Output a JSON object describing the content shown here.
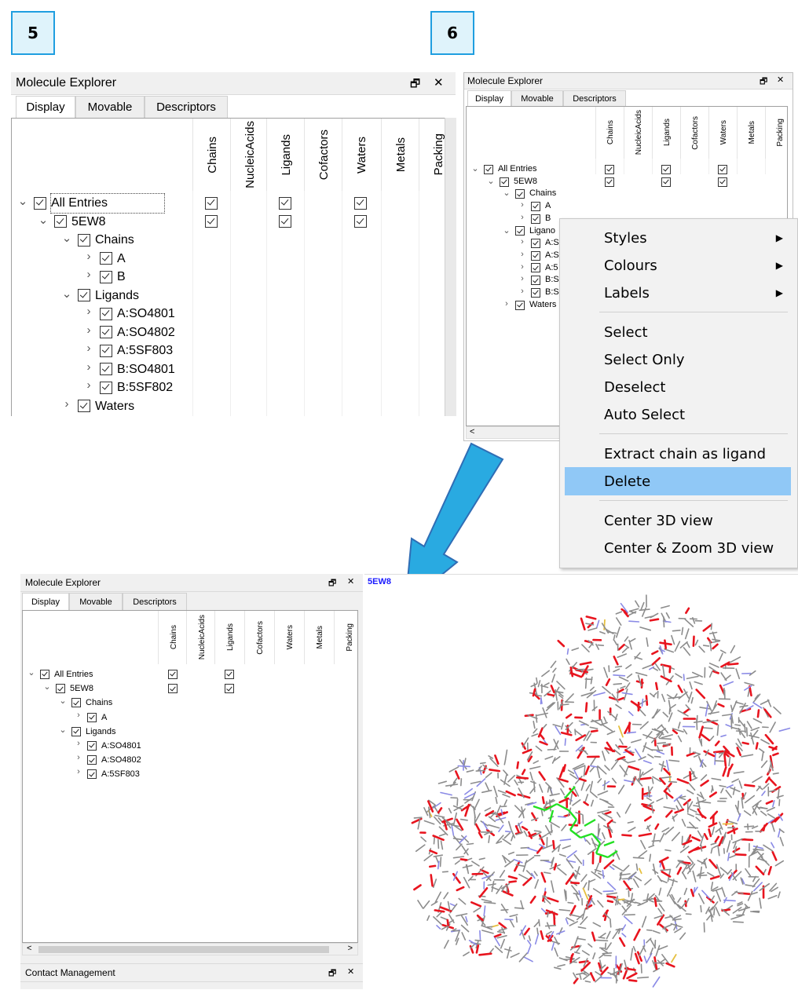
{
  "steps": [
    "5",
    "6"
  ],
  "panel_title": "Molecule Explorer",
  "panel_controls": {
    "float": "🗗",
    "close": "✕"
  },
  "tabs": [
    "Display",
    "Movable",
    "Descriptors"
  ],
  "columns": [
    "Chains",
    "NucleicAcids",
    "Ligands",
    "Cofactors",
    "Waters",
    "Metals",
    "Packing"
  ],
  "expander": {
    "open": "⌄",
    "closed": "›"
  },
  "tree5": [
    {
      "label": "All Entries",
      "expander": "open"
    },
    {
      "label": "5EW8",
      "expander": "open"
    },
    {
      "label": "Chains",
      "expander": "open"
    },
    {
      "label": "A",
      "expander": "closed"
    },
    {
      "label": "B",
      "expander": "closed"
    },
    {
      "label": "Ligands",
      "expander": "open"
    },
    {
      "label": "A:SO4801",
      "expander": "closed"
    },
    {
      "label": "A:SO4802",
      "expander": "closed"
    },
    {
      "label": "A:5SF803",
      "expander": "closed"
    },
    {
      "label": "B:SO4801",
      "expander": "closed"
    },
    {
      "label": "B:5SF802",
      "expander": "closed"
    },
    {
      "label": "Waters",
      "expander": "closed"
    }
  ],
  "tree6": [
    {
      "label": "All Entries"
    },
    {
      "label": "5EW8"
    },
    {
      "label": "Chains"
    },
    {
      "label": "A"
    },
    {
      "label": "B"
    },
    {
      "label": "Ligano"
    },
    {
      "label": "A:S"
    },
    {
      "label": "A:S"
    },
    {
      "label": "A:5"
    },
    {
      "label": "B:S"
    },
    {
      "label": "B:S"
    },
    {
      "label": "Waters"
    }
  ],
  "tree_result": [
    {
      "label": "All Entries"
    },
    {
      "label": "5EW8"
    },
    {
      "label": "Chains"
    },
    {
      "label": "A"
    },
    {
      "label": "Ligands"
    },
    {
      "label": "A:SO4801"
    },
    {
      "label": "A:SO4802"
    },
    {
      "label": "A:5SF803"
    }
  ],
  "context_menu": {
    "items": [
      {
        "label": "Styles",
        "submenu": true
      },
      {
        "label": "Colours",
        "submenu": true
      },
      {
        "label": "Labels",
        "submenu": true
      },
      {
        "label": "Select"
      },
      {
        "label": "Select Only"
      },
      {
        "label": "Deselect"
      },
      {
        "label": "Auto Select"
      },
      {
        "label": "Extract chain as ligand"
      },
      {
        "label": "Delete",
        "highlighted": true
      },
      {
        "label": "Center 3D view"
      },
      {
        "label": "Center & Zoom 3D view"
      }
    ],
    "submenu_arrow": "▶"
  },
  "scroll": {
    "left": "<",
    "right": ">"
  },
  "viewer": {
    "entry_label": "5EW8",
    "entry_label_color": "#1a1aff"
  },
  "contact_panel_title": "Contact Management",
  "colors": {
    "arrow_fill": "#29aae1",
    "arrow_stroke": "#2f6db5",
    "menu_highlight": "#90c8f6",
    "carbon": "#8c8c8c",
    "oxygen": "#e8141e",
    "nitrogen": "#8a8ae6",
    "ligand": "#22e022",
    "sulfur": "#e6c040"
  }
}
